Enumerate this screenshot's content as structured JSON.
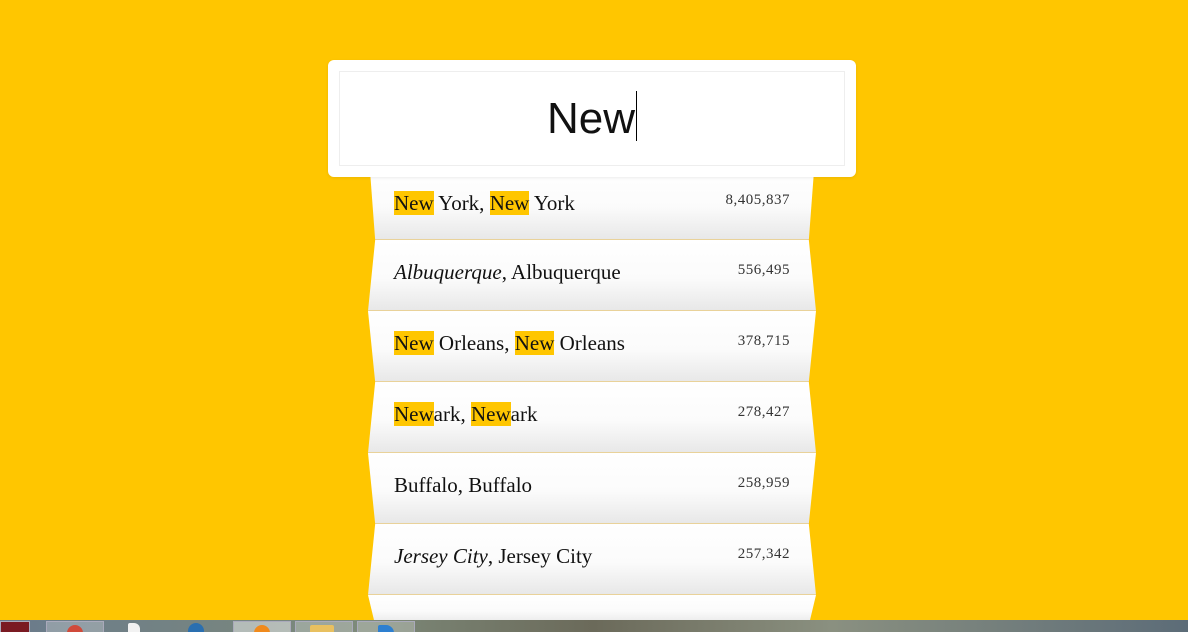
{
  "search": {
    "value": "New"
  },
  "results": [
    {
      "parts": [
        {
          "text": "New",
          "highlight": true,
          "italic": false
        },
        {
          "text": " York, ",
          "highlight": false,
          "italic": false
        },
        {
          "text": "New",
          "highlight": true,
          "italic": false
        },
        {
          "text": " York",
          "highlight": false,
          "italic": false
        }
      ],
      "population": "8,405,837"
    },
    {
      "parts": [
        {
          "text": "Albuquerque",
          "highlight": false,
          "italic": true
        },
        {
          "text": ", Albuquerque",
          "highlight": false,
          "italic": false
        }
      ],
      "population": "556,495"
    },
    {
      "parts": [
        {
          "text": "New",
          "highlight": true,
          "italic": false
        },
        {
          "text": " Orleans, ",
          "highlight": false,
          "italic": false
        },
        {
          "text": "New",
          "highlight": true,
          "italic": false
        },
        {
          "text": " Orleans",
          "highlight": false,
          "italic": false
        }
      ],
      "population": "378,715"
    },
    {
      "parts": [
        {
          "text": "New",
          "highlight": true,
          "italic": false
        },
        {
          "text": "ark, ",
          "highlight": false,
          "italic": false
        },
        {
          "text": "New",
          "highlight": true,
          "italic": false
        },
        {
          "text": "ark",
          "highlight": false,
          "italic": false
        }
      ],
      "population": "278,427"
    },
    {
      "parts": [
        {
          "text": "Buffalo, Buffalo",
          "highlight": false,
          "italic": false
        }
      ],
      "population": "258,959"
    },
    {
      "parts": [
        {
          "text": "Jersey City",
          "highlight": false,
          "italic": true
        },
        {
          "text": ", Jersey City",
          "highlight": false,
          "italic": false
        }
      ],
      "population": "257,342"
    }
  ],
  "colors": {
    "background": "#ffc600",
    "highlight": "#ffc600",
    "card": "#ffffff"
  },
  "taskbar": {
    "icons": [
      "app-icon",
      "chrome-icon",
      "document-icon",
      "chat-icon",
      "browser-icon",
      "folder-icon",
      "editor-icon"
    ]
  }
}
